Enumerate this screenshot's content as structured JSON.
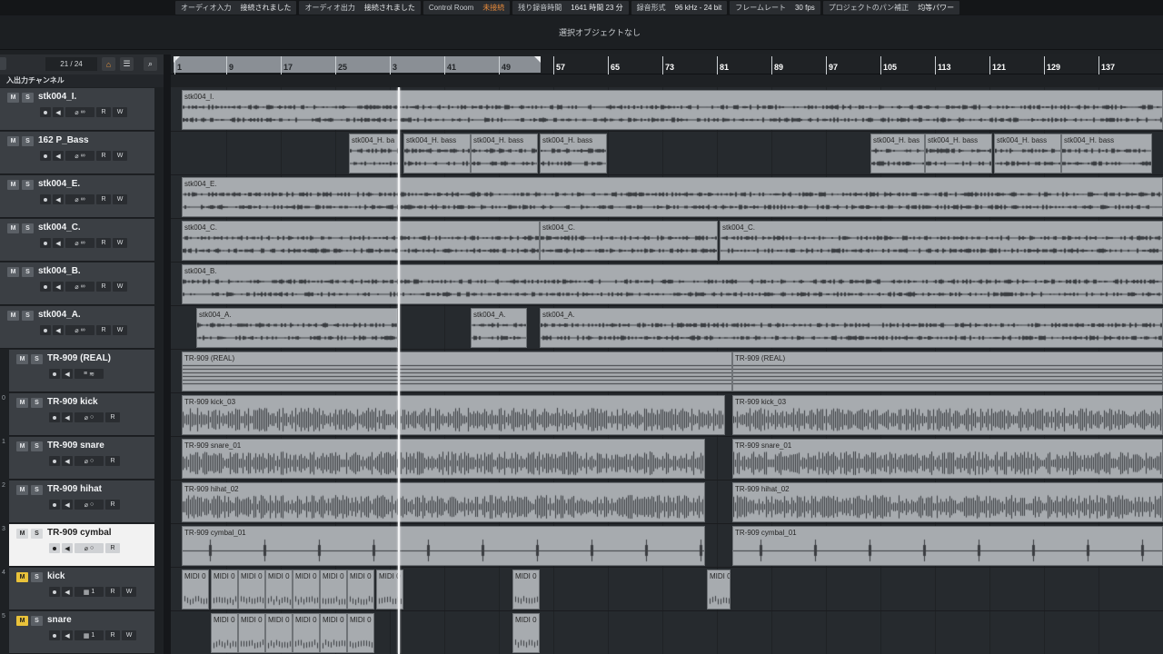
{
  "status_bar": [
    {
      "label": "オーディオ入力",
      "value": "接続されました"
    },
    {
      "label": "オーディオ出力",
      "value": "接続されました"
    },
    {
      "label": "Control Room",
      "value": "未接続",
      "warn": true
    },
    {
      "label": "残り録音時間",
      "value": "1641 時間 23 分"
    },
    {
      "label": "録音形式",
      "value": "96 kHz - 24 bit"
    },
    {
      "label": "フレームレート",
      "value": "30 fps"
    },
    {
      "label": "プロジェクトのパン補正",
      "value": "均等パワー"
    }
  ],
  "info_line": {
    "text": "選択オブジェクトなし"
  },
  "track_list": {
    "track_count": "21 / 24",
    "section_label": "入出力チャンネル"
  },
  "ruler": {
    "labels": [
      "1",
      "9",
      "17",
      "25",
      "3",
      "41",
      "49",
      "57",
      "65",
      "73",
      "81",
      "89",
      "97",
      "105",
      "113",
      "121",
      "129",
      "137"
    ]
  },
  "tracks": [
    {
      "name": "stk004_I.",
      "m": "M",
      "s": "S",
      "num": "",
      "edit": "⌀",
      "mon": "∞",
      "r": "R",
      "w": "W"
    },
    {
      "name": "162 P_Bass",
      "m": "M",
      "s": "S",
      "num": "",
      "edit": "⌀",
      "mon": "∞",
      "r": "R",
      "w": "W"
    },
    {
      "name": "stk004_E.",
      "m": "M",
      "s": "S",
      "num": "",
      "edit": "⌀",
      "mon": "∞",
      "r": "R",
      "w": "W"
    },
    {
      "name": "stk004_C.",
      "m": "M",
      "s": "S",
      "num": "",
      "edit": "⌀",
      "mon": "∞",
      "r": "R",
      "w": "W"
    },
    {
      "name": "stk004_B.",
      "m": "M",
      "s": "S",
      "num": "",
      "edit": "⌀",
      "mon": "∞",
      "r": "R",
      "w": "W"
    },
    {
      "name": "stk004_A.",
      "m": "M",
      "s": "S",
      "num": "",
      "edit": "⌀",
      "mon": "∞",
      "r": "R",
      "w": "W"
    },
    {
      "name": "TR-909 (REAL)",
      "m": "M",
      "s": "S",
      "num": "",
      "edit": "≡",
      "mon": "≋",
      "r": "",
      "w": ""
    },
    {
      "name": "TR-909 kick",
      "m": "M",
      "s": "S",
      "num": "0",
      "edit": "⌀",
      "mon": "○",
      "r": "R",
      "w": ""
    },
    {
      "name": "TR-909 snare",
      "m": "M",
      "s": "S",
      "num": "1",
      "edit": "⌀",
      "mon": "○",
      "r": "R",
      "w": ""
    },
    {
      "name": "TR-909 hihat",
      "m": "M",
      "s": "S",
      "num": "2",
      "edit": "⌀",
      "mon": "○",
      "r": "R",
      "w": ""
    },
    {
      "name": "TR-909 cymbal",
      "m": "M",
      "s": "S",
      "num": "3",
      "edit": "⌀",
      "mon": "○",
      "r": "R",
      "w": ""
    },
    {
      "name": "kick",
      "m": "M",
      "s": "S",
      "num": "4",
      "edit": "▦",
      "mon": "1",
      "r": "R",
      "w": "W"
    },
    {
      "name": "snare",
      "m": "M",
      "s": "S",
      "num": "5",
      "edit": "▦",
      "mon": "1",
      "r": "R",
      "w": "W"
    }
  ],
  "events": [
    [
      {
        "name": "stk004_I."
      }
    ],
    [
      {
        "name": "stk004_H. ba"
      },
      {
        "name": "stk004_H. bass"
      },
      {
        "name": "stk004_H. bass"
      },
      {
        "name": "stk004_H. bass"
      },
      {
        "name": "stk004_H. bas"
      },
      {
        "name": "stk004_H. bass"
      },
      {
        "name": "stk004_H. bass"
      },
      {
        "name": "stk004_H. bass"
      }
    ],
    [
      {
        "name": "stk004_E."
      }
    ],
    [
      {
        "name": "stk004_C."
      },
      {
        "name": "stk004_C."
      },
      {
        "name": "stk004_C."
      }
    ],
    [
      {
        "name": "stk004_B."
      }
    ],
    [
      {
        "name": "stk004_A."
      },
      {
        "name": "stk004_A."
      },
      {
        "name": "stk004_A."
      }
    ],
    [
      {
        "name": "TR-909 (REAL)"
      },
      {
        "name": "TR-909 (REAL)"
      }
    ],
    [
      {
        "name": "TR-909 kick_03"
      },
      {
        "name": "TR-909 kick_03"
      }
    ],
    [
      {
        "name": "TR-909 snare_01"
      },
      {
        "name": "TR-909 snare_01"
      }
    ],
    [
      {
        "name": "TR-909 hihat_02"
      },
      {
        "name": "TR-909 hihat_02"
      }
    ],
    [
      {
        "name": "TR-909 cymbal_01"
      },
      {
        "name": "TR-909 cymbal_01"
      }
    ],
    [
      {
        "name": "MIDI 0"
      },
      {
        "name": "MIDI 0"
      },
      {
        "name": "MIDI 0"
      },
      {
        "name": "MIDI 0"
      },
      {
        "name": "MIDI 0"
      },
      {
        "name": "MIDI 0"
      },
      {
        "name": "MIDI 0"
      },
      {
        "name": "MIDI 0"
      },
      {
        "name": "MIDI 0"
      },
      {
        "name": "MIDI 0"
      }
    ],
    [
      {
        "name": "MIDI 0"
      },
      {
        "name": "MIDI 0"
      },
      {
        "name": "MIDI 0"
      },
      {
        "name": "MIDI 0"
      },
      {
        "name": "MIDI 0"
      },
      {
        "name": "MIDI 0"
      },
      {
        "name": "MIDI 0"
      }
    ]
  ],
  "colors": {
    "accent": "#e8953c",
    "meter": "#2dd3b2",
    "record": "#d8344a",
    "mute_on": "#e9c23a",
    "event": "#a7abaf"
  }
}
